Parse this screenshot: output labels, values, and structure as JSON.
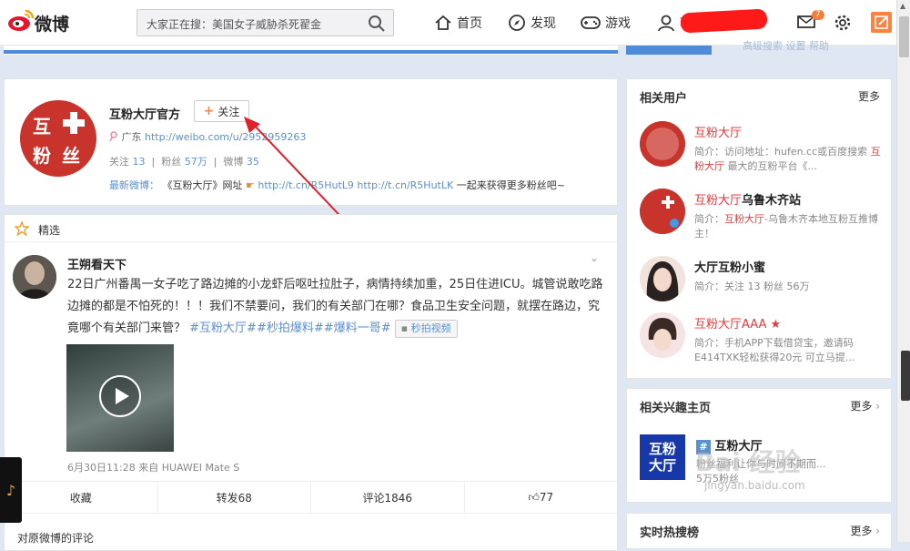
{
  "header": {
    "logo_text": "微博",
    "search_placeholder": "大家正在搜：美国女子威胁杀死翟金",
    "nav": [
      {
        "label": "首页"
      },
      {
        "label": "发现"
      },
      {
        "label": "游戏"
      }
    ],
    "user_prefix": "辑",
    "mail_badge": "7",
    "ghost_tabs": "高级搜索          设置          帮助"
  },
  "profile": {
    "avatar_chars": [
      "互",
      "粉",
      "丝"
    ],
    "name": "互粉大厅官方",
    "follow_label": "关注",
    "location": "广东",
    "url": "http://weibo.com/u/2952959263",
    "stats": {
      "follow_label": "关注",
      "follow_count": "13",
      "fans_label": "粉丝",
      "fans_count": "57万",
      "weibo_label": "微博",
      "weibo_count": "35"
    },
    "latest_label": "最新微博：",
    "latest_text": "《互粉大厅》网址",
    "latest_links": "http://t.cn/R5HutL9 http://t.cn/R5HutLK",
    "latest_tail": "一起来获得更多粉丝吧~"
  },
  "feed": {
    "title": "精选",
    "post": {
      "author": "王朔看天下",
      "text": "22日广州番禺一女子吃了路边摊的小龙虾后呕吐拉肚子，病情持续加重，25日住进ICU。城管说敢吃路边摊的都是不怕死的！！！我们不禁要问，我们的有关部门在哪？食品卫生安全问题，就摆在路边，究竟哪个有关部门来管？",
      "tags": "#互粉大厅##秒拍爆料##爆料一哥#",
      "video_chip": "秒拍视频",
      "meta": "6月30日11:28 来自 HUAWEI Mate S",
      "actions": {
        "collect": "收藏",
        "repost": "转发68",
        "comment": "评论1846",
        "like": "77"
      }
    },
    "orig_comments": "对原微博的评论"
  },
  "related_users": {
    "title": "相关用户",
    "more": "更多",
    "users": [
      {
        "name": "互粉大厅",
        "desc_prefix": "简介：访问地址：hufen.cc或百度搜索",
        "desc_red": "互粉大厅",
        "desc_suffix": "最大的互粉平台《..."
      },
      {
        "name": "互粉大厅",
        "name_suffix": "乌鲁木齐站",
        "desc_prefix": "简介：",
        "desc_red": "互粉大厅",
        "desc_suffix": "-乌鲁木齐本地互粉互推博主！"
      },
      {
        "name": "大厅互粉小蜜",
        "desc_prefix": "简介：关注 13 粉丝 56万"
      },
      {
        "name": "互粉大厅AAA",
        "desc_prefix": "简介：手机APP下载借贷宝，邀请码E414TXK轻松获得20元 可立马提..."
      }
    ]
  },
  "interest": {
    "title": "相关兴趣主页",
    "more": "更多",
    "avatar_text": "互粉\n大厅",
    "name": "互粉大厅",
    "desc": "粉丝福利让你与时间不期而...\n5万5粉丝"
  },
  "hot": {
    "title": "实时热搜榜",
    "more": "更多"
  },
  "watermark": {
    "main": "Bai 经验",
    "sub": "jingyan.baidu.com"
  },
  "colors": {
    "brand_orange": "#ff8140",
    "link_blue": "#5a8fd0",
    "red": "#e4393c",
    "avatar_red": "#c8342c"
  }
}
